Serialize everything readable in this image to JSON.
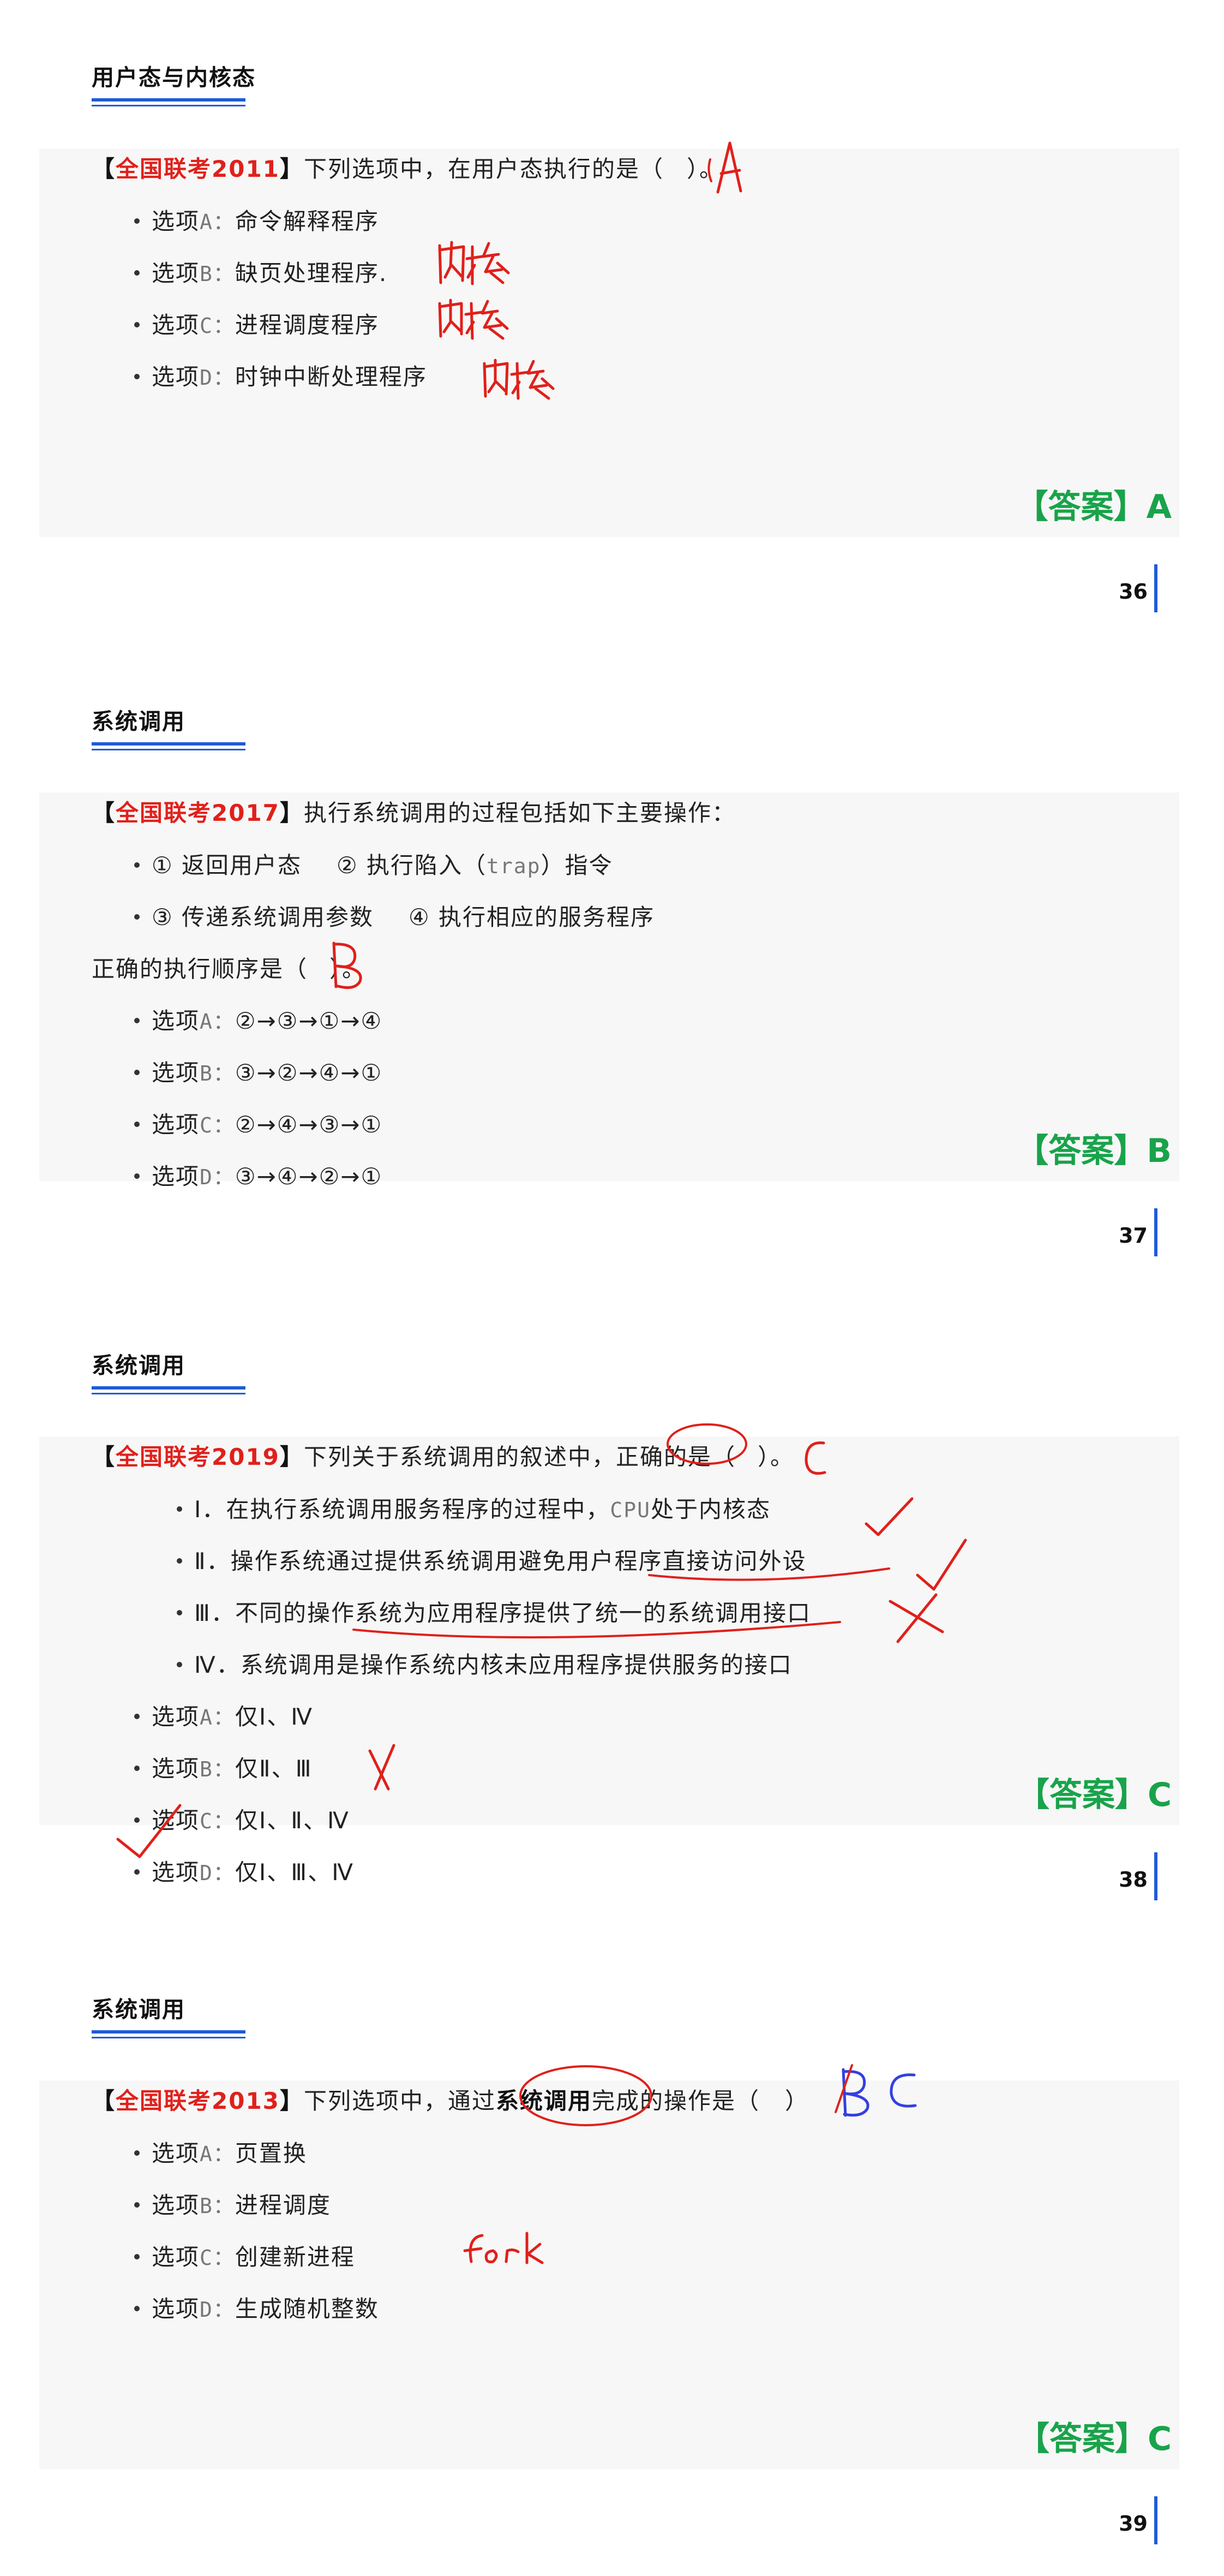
{
  "colors": {
    "accent_blue": "#1e5bd8",
    "source_red": "#e0201b",
    "answer_green": "#19a34a",
    "ink_red": "#e0201b",
    "ink_blue": "#3340e0"
  },
  "slides": [
    {
      "title": "用户态与内核态",
      "source": "全国联考2011",
      "question": "下列选项中，在用户态执行的是（",
      "question_end": "）。",
      "items": [
        {
          "prefix": "选项",
          "code": "A：",
          "text": "命令解释程序"
        },
        {
          "prefix": "选项",
          "code": "B：",
          "text": "缺页处理程序."
        },
        {
          "prefix": "选项",
          "code": "C：",
          "text": "进程调度程序"
        },
        {
          "prefix": "选项",
          "code": "D：",
          "text": "时钟中断处理程序"
        }
      ],
      "answer_label": "【答案】",
      "answer": "A",
      "page": "36",
      "handwriting": [
        "A",
        "内核",
        "内核",
        "内核"
      ]
    },
    {
      "title": "系统调用",
      "source": "全国联考2017",
      "question": "执行系统调用的过程包括如下主要操作：",
      "steps": [
        {
          "a": "① 返回用户态",
          "b": "② 执行陷入（",
          "b_code": "trap",
          "b_end": "）指令"
        },
        {
          "a": "③ 传递系统调用参数",
          "b": "④ 执行相应的服务程序",
          "b_code": "",
          "b_end": ""
        }
      ],
      "order_q": "正确的执行顺序是（",
      "order_end": "）。",
      "items": [
        {
          "prefix": "选项",
          "code": "A：",
          "text": "②→③→①→④"
        },
        {
          "prefix": "选项",
          "code": "B：",
          "text": "③→②→④→①"
        },
        {
          "prefix": "选项",
          "code": "C：",
          "text": "②→④→③→①"
        },
        {
          "prefix": "选项",
          "code": "D：",
          "text": "③→④→②→①"
        }
      ],
      "answer_label": "【答案】",
      "answer": "B",
      "page": "37",
      "handwriting": [
        "B"
      ]
    },
    {
      "title": "系统调用",
      "source": "全国联考2019",
      "question": "下列关于系统调用的叙述中，正确的是（",
      "question_end": "）。",
      "statements": [
        {
          "text_before": "Ⅰ．在执行系统调用服务程序的过程中，",
          "code": "CPU",
          "text_after": "处于内核态"
        },
        {
          "text_before": "Ⅱ．操作系统通过提供系统调用避免用户程序直接访问外设",
          "code": "",
          "text_after": ""
        },
        {
          "text_before": "Ⅲ．不同的操作系统为应用程序提供了统一的系统调用接口",
          "code": "",
          "text_after": ""
        },
        {
          "text_before": "Ⅳ．系统调用是操作系统内核未应用程序提供服务的接口",
          "code": "",
          "text_after": ""
        }
      ],
      "items": [
        {
          "prefix": "选项",
          "code": "A：",
          "text": "仅Ⅰ、Ⅳ"
        },
        {
          "prefix": "选项",
          "code": "B：",
          "text": "仅Ⅱ、Ⅲ"
        },
        {
          "prefix": "选项",
          "code": "C：",
          "text": "仅Ⅰ、Ⅱ、Ⅳ"
        },
        {
          "prefix": "选项",
          "code": "D：",
          "text": "仅Ⅰ、Ⅲ、Ⅳ"
        }
      ],
      "answer_label": "【答案】",
      "answer": "C",
      "page": "38",
      "handwriting": [
        "C"
      ]
    },
    {
      "title": "系统调用",
      "source": "全国联考2013",
      "question_before": "下列选项中，通过",
      "question_bold": "系统调用",
      "question_after": "完成的操作是（",
      "question_end": "）",
      "items": [
        {
          "prefix": "选项",
          "code": "A：",
          "text": "页置换"
        },
        {
          "prefix": "选项",
          "code": "B：",
          "text": "进程调度"
        },
        {
          "prefix": "选项",
          "code": "C：",
          "text": "创建新进程"
        },
        {
          "prefix": "选项",
          "code": "D：",
          "text": "生成随机整数"
        }
      ],
      "answer_label": "【答案】",
      "answer": "C",
      "page": "39",
      "handwriting": [
        "B",
        "C",
        "fork"
      ]
    }
  ]
}
